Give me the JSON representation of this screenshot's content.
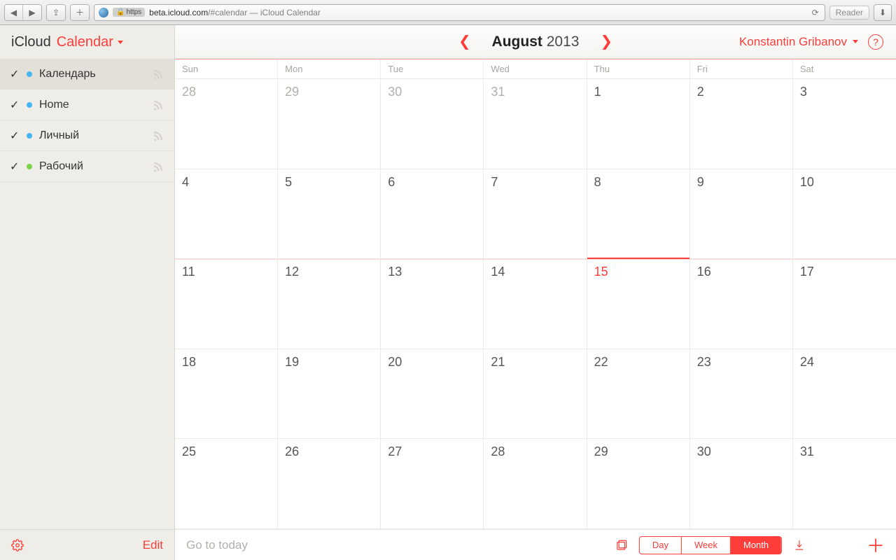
{
  "browser": {
    "url_protocol": "https",
    "url_domain": "beta.icloud.com",
    "url_path": "/#calendar — iCloud Calendar",
    "reader_label": "Reader"
  },
  "sidebar": {
    "brand": "iCloud",
    "app": "Calendar",
    "items": [
      {
        "label": "Календарь",
        "color": "#46b5f0"
      },
      {
        "label": "Home",
        "color": "#46b5f0"
      },
      {
        "label": "Личный",
        "color": "#46b5f0"
      },
      {
        "label": "Рабочий",
        "color": "#7bd34b"
      }
    ],
    "edit_label": "Edit"
  },
  "header": {
    "month": "August",
    "year": "2013",
    "user": "Konstantin Gribanov"
  },
  "weekdays": [
    "Sun",
    "Mon",
    "Tue",
    "Wed",
    "Thu",
    "Fri",
    "Sat"
  ],
  "grid": {
    "rows": [
      [
        {
          "n": "28",
          "faded": true
        },
        {
          "n": "29",
          "faded": true
        },
        {
          "n": "30",
          "faded": true
        },
        {
          "n": "31",
          "faded": true
        },
        {
          "n": "1"
        },
        {
          "n": "2"
        },
        {
          "n": "3"
        }
      ],
      [
        {
          "n": "4"
        },
        {
          "n": "5"
        },
        {
          "n": "6"
        },
        {
          "n": "7"
        },
        {
          "n": "8"
        },
        {
          "n": "9"
        },
        {
          "n": "10"
        }
      ],
      [
        {
          "n": "11"
        },
        {
          "n": "12"
        },
        {
          "n": "13"
        },
        {
          "n": "14"
        },
        {
          "n": "15",
          "today": true
        },
        {
          "n": "16"
        },
        {
          "n": "17"
        }
      ],
      [
        {
          "n": "18"
        },
        {
          "n": "19"
        },
        {
          "n": "20"
        },
        {
          "n": "21"
        },
        {
          "n": "22"
        },
        {
          "n": "23"
        },
        {
          "n": "24"
        }
      ],
      [
        {
          "n": "25"
        },
        {
          "n": "26"
        },
        {
          "n": "27"
        },
        {
          "n": "28"
        },
        {
          "n": "29"
        },
        {
          "n": "30"
        },
        {
          "n": "31"
        }
      ]
    ]
  },
  "footer": {
    "go_today": "Go to today",
    "views": [
      {
        "label": "Day",
        "active": false
      },
      {
        "label": "Week",
        "active": false
      },
      {
        "label": "Month",
        "active": true
      }
    ]
  },
  "colors": {
    "accent": "#fc3d39"
  }
}
